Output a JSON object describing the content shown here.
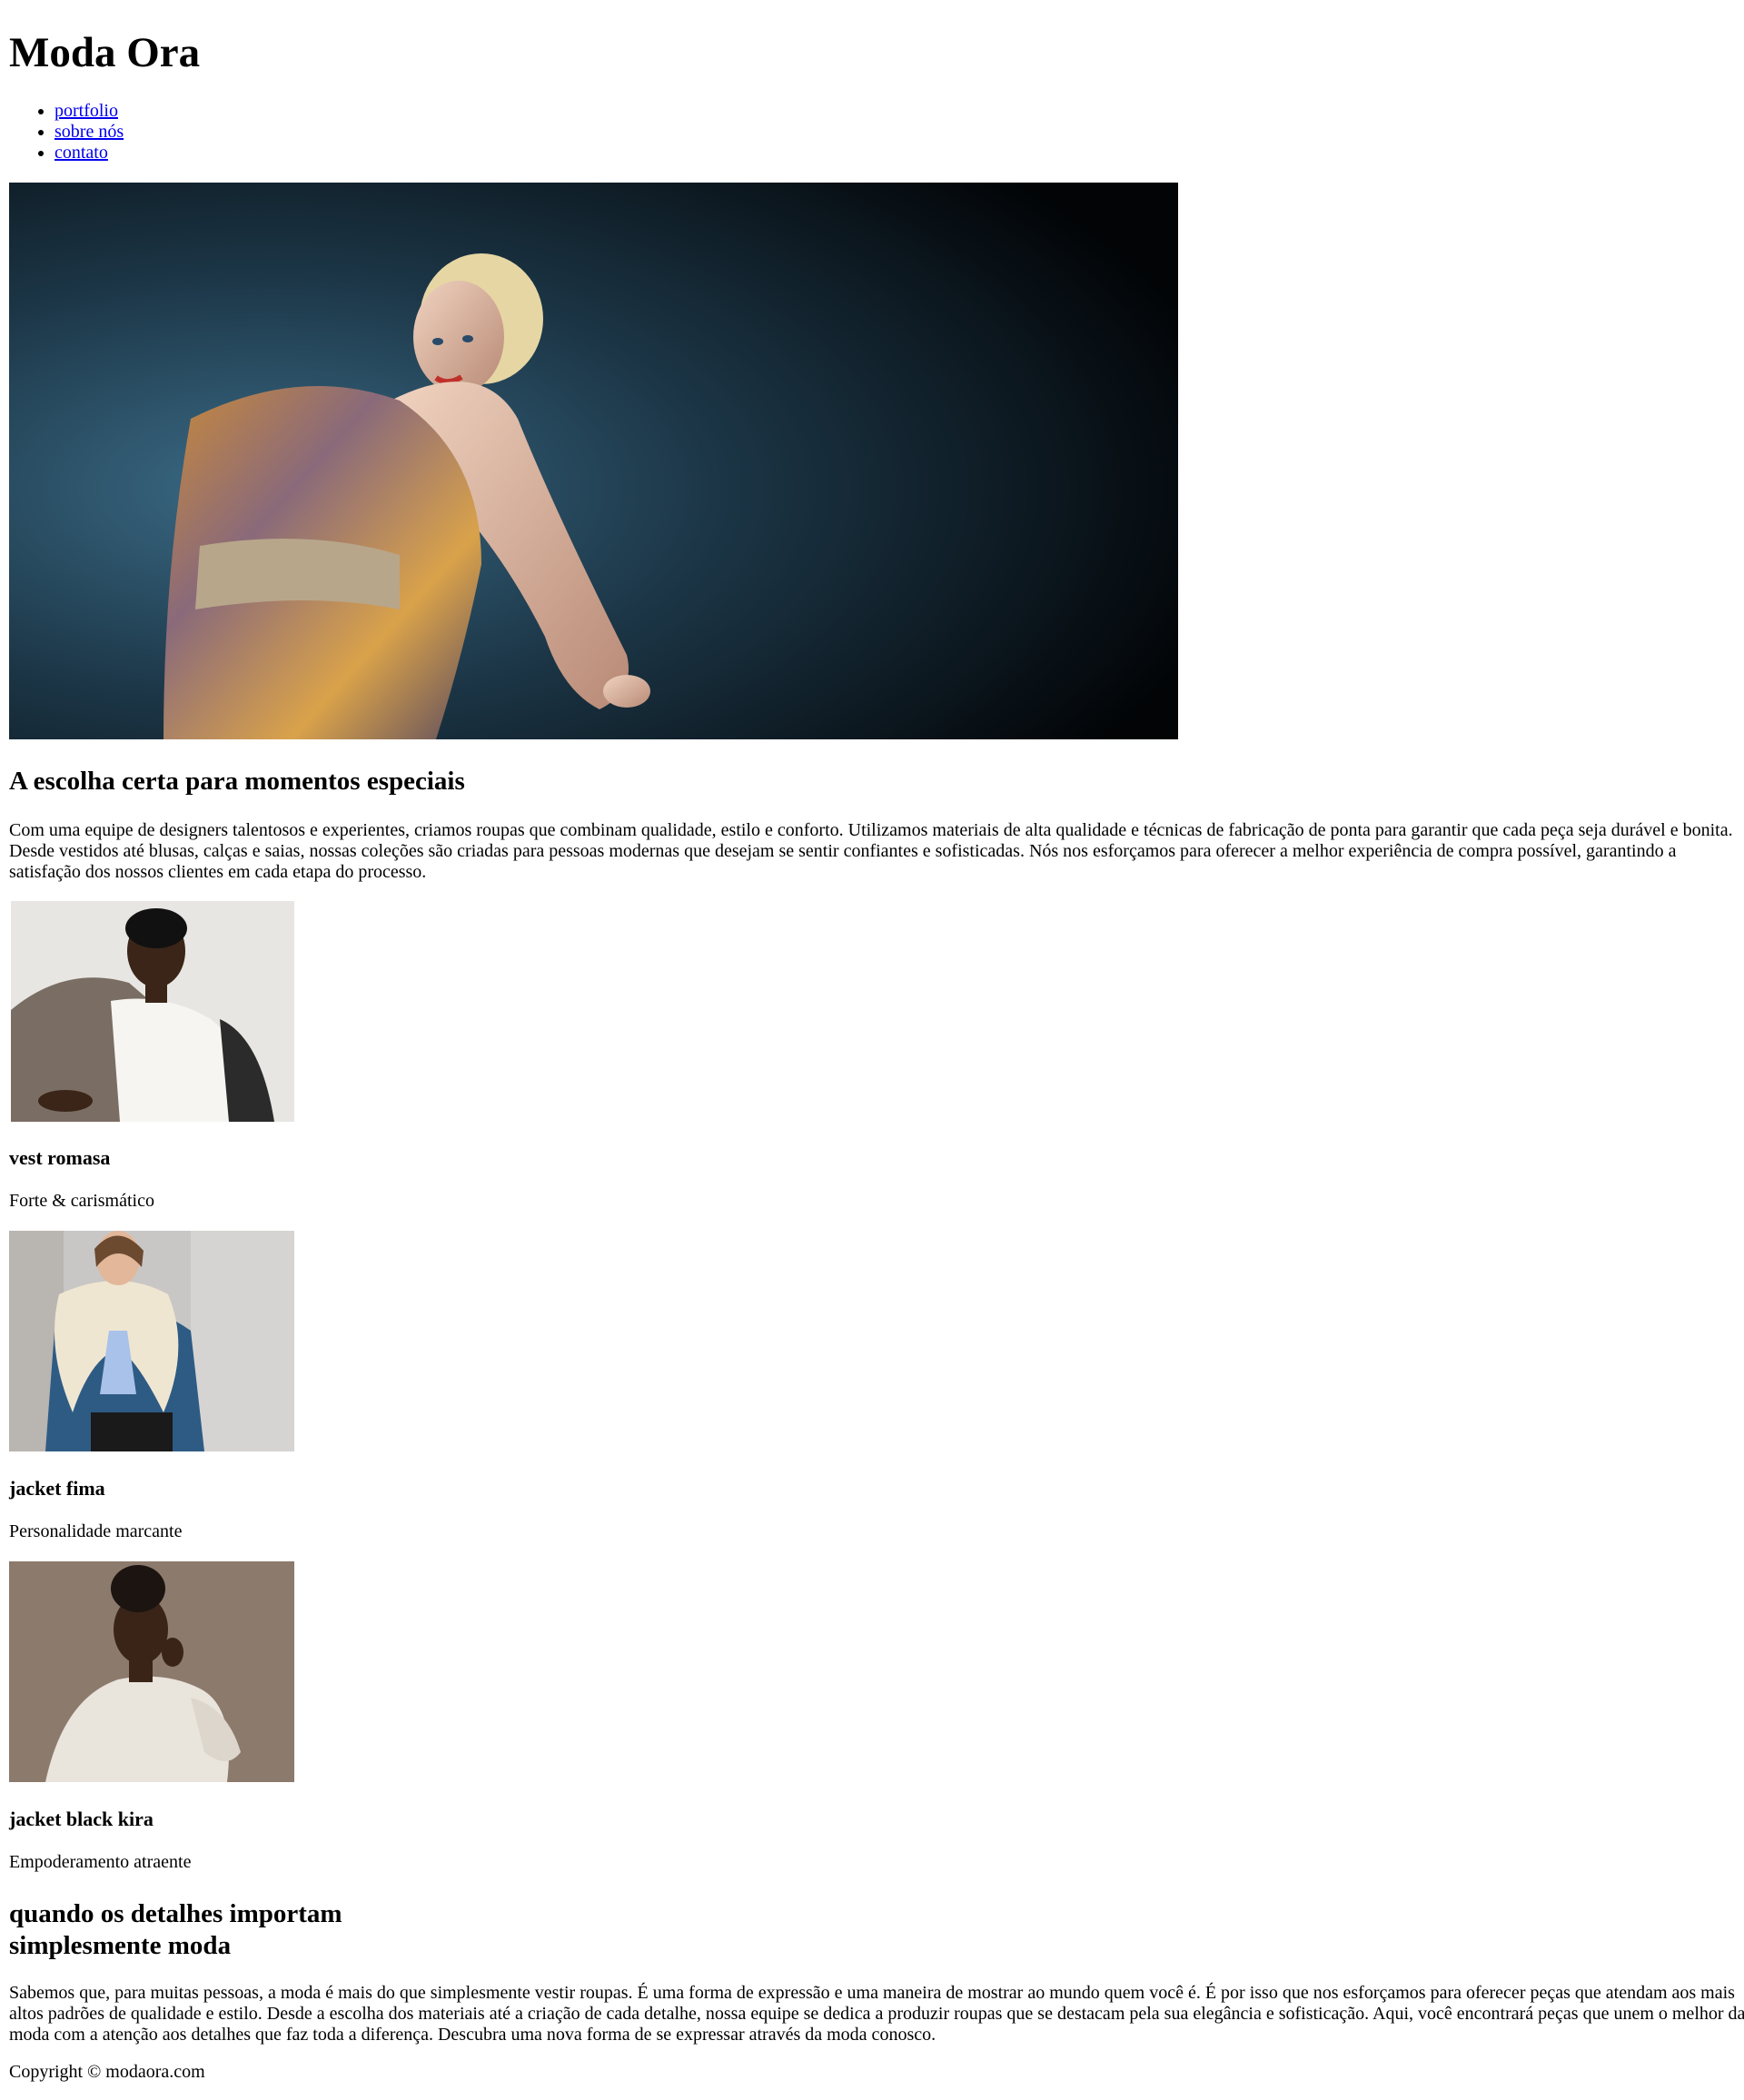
{
  "site": {
    "title": "Moda Ora"
  },
  "nav": {
    "items": [
      "portfolio",
      "sobre nós",
      "contato"
    ]
  },
  "hero": {
    "image_alt": "model in paisley dress on dark blue background"
  },
  "intro": {
    "heading": "A escolha certa para momentos especiais",
    "text": "Com uma equipe de designers talentosos e experientes, criamos roupas que combinam qualidade, estilo e conforto. Utilizamos materiais de alta qualidade e técnicas de fabricação de ponta para garantir que cada peça seja durável e bonita. Desde vestidos até blusas, calças e saias, nossas coleções são criadas para pessoas modernas que desejam se sentir confiantes e sofisticadas. Nós nos esforçamos para oferecer a melhor experiência de compra possível, garantindo a satisfação dos nossos clientes em cada etapa do processo."
  },
  "products": [
    {
      "name": "vest romasa",
      "desc": "Forte & carismático"
    },
    {
      "name": "jacket fima",
      "desc": "Personalidade marcante"
    },
    {
      "name": "jacket black kira",
      "desc": "Empoderamento atraente"
    }
  ],
  "details": {
    "heading_line1": "quando os detalhes importam",
    "heading_line2": "simplesmente moda",
    "text": "Sabemos que, para muitas pessoas, a moda é mais do que simplesmente vestir roupas. É uma forma de expressão e uma maneira de mostrar ao mundo quem você é. É por isso que nos esforçamos para oferecer peças que atendam aos mais altos padrões de qualidade e estilo. Desde a escolha dos materiais até a criação de cada detalhe, nossa equipe se dedica a produzir roupas que se destacam pela sua elegância e sofisticação. Aqui, você encontrará peças que unem o melhor da moda com a atenção aos detalhes que faz toda a diferença. Descubra uma nova forma de se expressar através da moda conosco."
  },
  "footer": {
    "copyright": "Copyright © modaora.com"
  },
  "colors": {
    "link": "#0000ee",
    "hero_bg_light": "#2f5670",
    "hero_bg_dark": "#000000"
  }
}
